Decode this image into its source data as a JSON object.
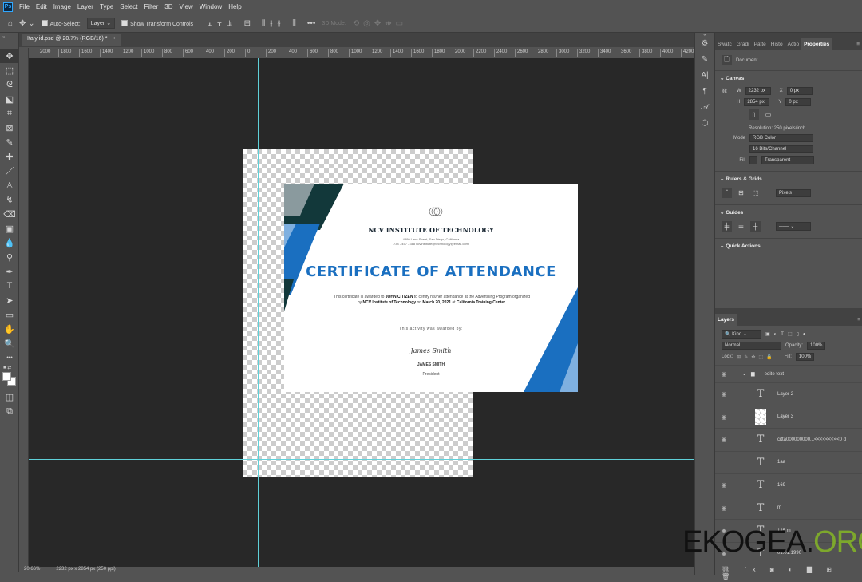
{
  "menu": {
    "items": [
      "File",
      "Edit",
      "Image",
      "Layer",
      "Type",
      "Select",
      "Filter",
      "3D",
      "View",
      "Window",
      "Help"
    ],
    "logo": "Ps"
  },
  "options": {
    "auto_select_label": "Auto-Select:",
    "auto_select_value": "Layer",
    "show_transform_label": "Show Transform Controls",
    "mode_3d": "3D Mode:"
  },
  "document_tab": {
    "title": "Italy id.psd @ 20.7% (RGB/16) *",
    "close": "×"
  },
  "tools": [
    {
      "name": "move-tool",
      "glyph": "✥"
    },
    {
      "name": "marquee-tool",
      "glyph": "⬚"
    },
    {
      "name": "lasso-tool",
      "glyph": "ᘓ"
    },
    {
      "name": "object-select-tool",
      "glyph": "⬕"
    },
    {
      "name": "crop-tool",
      "glyph": "⌗"
    },
    {
      "name": "frame-tool",
      "glyph": "⊠"
    },
    {
      "name": "eyedropper-tool",
      "glyph": "✎"
    },
    {
      "name": "healing-tool",
      "glyph": "✚"
    },
    {
      "name": "brush-tool",
      "glyph": "／"
    },
    {
      "name": "stamp-tool",
      "glyph": "♙"
    },
    {
      "name": "history-brush-tool",
      "glyph": "↯"
    },
    {
      "name": "eraser-tool",
      "glyph": "⌫"
    },
    {
      "name": "gradient-tool",
      "glyph": "▣"
    },
    {
      "name": "blur-tool",
      "glyph": "💧"
    },
    {
      "name": "dodge-tool",
      "glyph": "⚲"
    },
    {
      "name": "pen-tool",
      "glyph": "✒"
    },
    {
      "name": "type-tool",
      "glyph": "T"
    },
    {
      "name": "path-select-tool",
      "glyph": "➤"
    },
    {
      "name": "rectangle-tool",
      "glyph": "▭"
    },
    {
      "name": "hand-tool",
      "glyph": "✋"
    },
    {
      "name": "zoom-tool",
      "glyph": "🔍"
    },
    {
      "name": "more-tools",
      "glyph": "•••"
    }
  ],
  "ruler": {
    "labels": [
      "2000",
      "1800",
      "1600",
      "1400",
      "1200",
      "1000",
      "800",
      "600",
      "400",
      "200",
      "0",
      "200",
      "400",
      "600",
      "800",
      "1000",
      "1200",
      "1400",
      "1600",
      "1800",
      "2000",
      "2200",
      "2400",
      "2600",
      "2800",
      "3000",
      "3200",
      "3400",
      "3600",
      "3800",
      "4000",
      "4200"
    ]
  },
  "certificate": {
    "institute": "NCV INSTITUTE OF TECHNOLOGY",
    "address": "4399 Lane Street, San Diego, California",
    "contact": "734 - 457 - 388  ncvinstitute@technology@email.com",
    "title": "CERTIFICATE OF ATTENDANCE",
    "body_1": "This certificate is awarded to ",
    "recipient": "JOHN CITIZEN",
    "body_2": " to certify his/her attendance at the Advertising Program organized by ",
    "org": "NCV Institute of Technology",
    "body_3": " on ",
    "date": "March 20, 2021",
    "body_4": " at ",
    "venue": "California Training Center.",
    "awarded_by": "This activity was awarded by:",
    "signature": "James Smith",
    "signer": "JAMES SMITH",
    "role": "President"
  },
  "status": {
    "zoom": "20.66%",
    "doc_size": "2232 px x 2854 px (250 ppi)"
  },
  "panel": {
    "tabs": [
      "Swatc",
      "Gradi",
      "Patte",
      "Histo",
      "Actio",
      "Properties"
    ],
    "doc_label": "Document",
    "canvas": "Canvas",
    "w_label": "W",
    "w": "2232 px",
    "h_label": "H",
    "h": "2854 px",
    "x_label": "X",
    "x": "0 px",
    "y_label": "Y",
    "y": "0 px",
    "resolution": "Resolution: 250 pixels/inch",
    "mode_label": "Mode",
    "mode": "RGB Color",
    "depth": "16 Bits/Channel",
    "fill_label": "Fill",
    "fill": "Transparent",
    "rulers": "Rulers & Grids",
    "units": "Pixels",
    "guides": "Guides",
    "quick_actions": "Quick Actions"
  },
  "layers": {
    "tab": "Layers",
    "kind": "Kind",
    "blend": "Normal",
    "opacity_label": "Opacity:",
    "opacity": "100%",
    "lock_label": "Lock:",
    "fill_label": "Fill:",
    "fill": "100%",
    "items": [
      {
        "name": "edite text",
        "type": "group"
      },
      {
        "name": "Layer 2",
        "type": "text"
      },
      {
        "name": "Layer 3",
        "type": "image"
      },
      {
        "name": "citta000000000...<<<<<<<<<0 d",
        "type": "text"
      },
      {
        "name": "1aa",
        "type": "text"
      },
      {
        "name": "169",
        "type": "text"
      },
      {
        "name": "m",
        "type": "text"
      },
      {
        "name": "125 m",
        "type": "text"
      },
      {
        "name": "01.01.1990",
        "type": "text"
      }
    ]
  },
  "watermark": {
    "main": "EKOGEA.",
    "tld": "ORG"
  },
  "colors": {
    "accent": "#1a6fc0",
    "guide": "#5fd0d8",
    "dark_teal": "#12383a"
  }
}
